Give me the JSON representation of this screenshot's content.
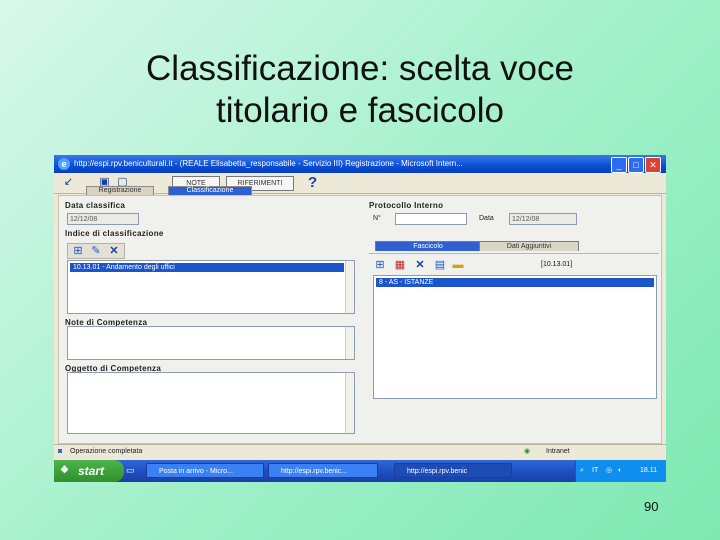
{
  "slide": {
    "title_line1": "Classificazione: scelta voce",
    "title_line2": "titolario e fascicolo",
    "page_number": "90"
  },
  "window": {
    "title": "http://espi.rpv.beniculturali.it - (REALE Elisabetta_responsabile - Servizio III) Registrazione - Microsoft Intern...",
    "buttons": {
      "minimize": "_",
      "maximize": "□",
      "close": "✕"
    }
  },
  "toolbar": {
    "note_label": "NOTE",
    "references_label": "RIFERIMENTI",
    "help_glyph": "?",
    "tabs": [
      {
        "label": "Registrazione",
        "active": false
      },
      {
        "label": "Classificazione",
        "active": true
      }
    ]
  },
  "form": {
    "data_classifica": {
      "label": "Data classifica",
      "value": "12/12/08"
    },
    "protocollo_interno": {
      "label": "Protocollo Interno",
      "num_label": "N°",
      "num_value": "",
      "date_label": "Data",
      "date_value": "12/12/08"
    },
    "indice": {
      "label": "Indice di classificazione",
      "selected_item": "10.13.01 - Andamento degli uffici"
    },
    "note_competenza": {
      "label": "Note di Competenza"
    },
    "oggetto_competenza": {
      "label": "Oggetto di Competenza"
    },
    "fascicolo_panel": {
      "tabs": [
        {
          "label": "Fascicolo",
          "active": true
        },
        {
          "label": "Dati Aggiuntivi",
          "active": false
        }
      ],
      "code": "[10.13.01]",
      "selected_item": "8 - AS - ISTANZE"
    }
  },
  "statusbar": {
    "status_text": "Operazione completata",
    "zone_text": "Intranet"
  },
  "taskbar": {
    "start_label": "start",
    "items": [
      {
        "label": "Posta in arrivo - Micro..."
      },
      {
        "label": "http://espi.rpv.benic..."
      },
      {
        "label": "http://espi.rpv.benic"
      }
    ],
    "tray_lang": "IT",
    "time": "18.11"
  }
}
